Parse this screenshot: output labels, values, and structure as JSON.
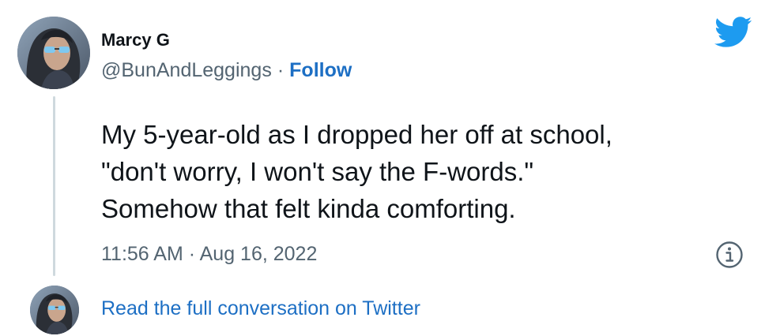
{
  "author": {
    "display_name": "Marcy G",
    "handle": "@BunAndLeggings",
    "separator": "·",
    "follow_label": "Follow"
  },
  "tweet": {
    "lines": [
      "My 5-year-old as I dropped her off at school,",
      "\"don't worry, I won't say the F-words.\"",
      "Somehow that felt kinda comforting."
    ],
    "timestamp": "11:56 AM · Aug 16, 2022"
  },
  "footer": {
    "read_more_label": "Read the full conversation on Twitter"
  },
  "icons": {
    "brand_logo": "twitter-bird-icon",
    "info": "info-icon"
  },
  "colors": {
    "brand_blue": "#1d9bf0",
    "link_blue": "#1d6fc4",
    "text": "#0f1419",
    "secondary_text": "#536471",
    "thread_line": "#cfd9de"
  }
}
